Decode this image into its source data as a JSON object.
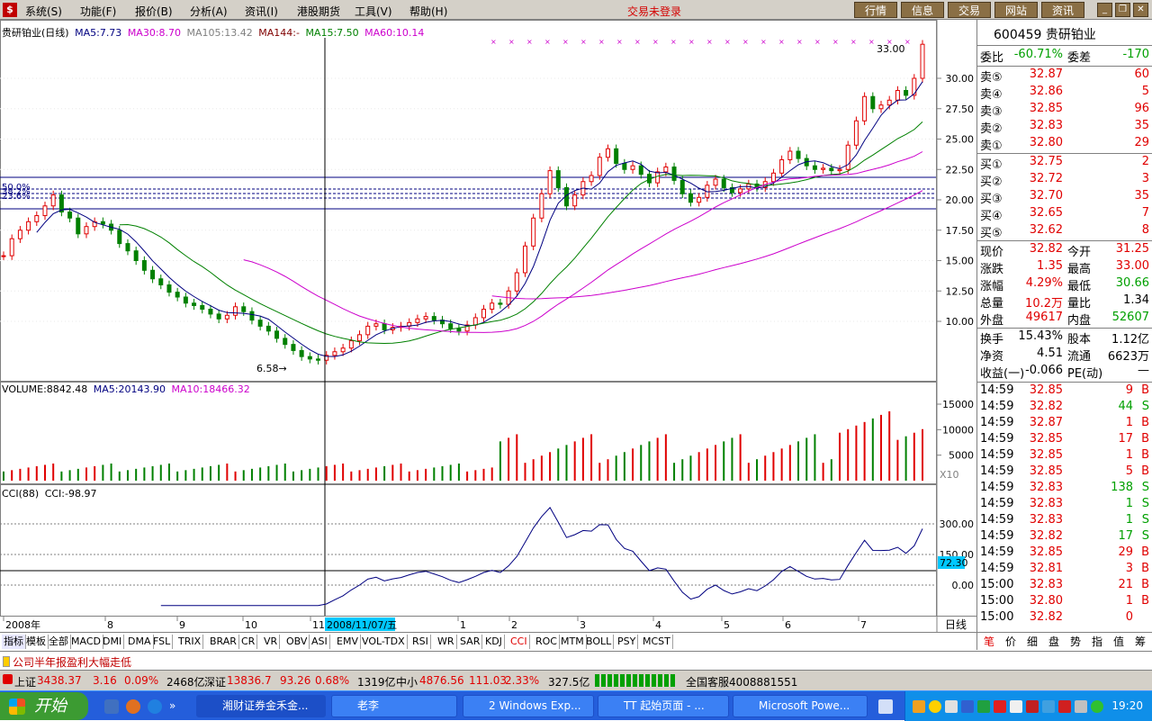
{
  "menubar": {
    "items": [
      "系统(S)",
      "功能(F)",
      "报价(B)",
      "分析(A)",
      "资讯(I)",
      "港股期货",
      "工具(V)",
      "帮助(H)"
    ],
    "login_status": "交易未登录",
    "nav_buttons": [
      "行情",
      "信息",
      "交易",
      "网站",
      "资讯"
    ]
  },
  "main_chart": {
    "legend": [
      {
        "text": "贵研铂业(日线)",
        "color": "#000000"
      },
      {
        "text": "MA5:7.73",
        "color": "#000080"
      },
      {
        "text": "MA30:8.70",
        "color": "#cc00cc"
      },
      {
        "text": "MA105:13.42",
        "color": "#808080"
      },
      {
        "text": "MA144:-",
        "color": "#800000"
      },
      {
        "text": "MA15:7.50",
        "color": "#008000"
      },
      {
        "text": "MA60:10.14",
        "color": "#cc00cc"
      }
    ],
    "price_axis": [
      "30.00",
      "27.50",
      "25.00",
      "22.50",
      "20.00",
      "17.50",
      "15.00",
      "12.50",
      "10.00"
    ],
    "high_label": "33.00",
    "low_label": "6.58",
    "fib_labels": [
      "50.0%",
      "38.2%",
      "23.6%"
    ]
  },
  "volume_chart": {
    "legend": [
      {
        "text": "VOLUME:8842.48",
        "color": "#000000"
      },
      {
        "text": "MA5:20143.90",
        "color": "#000080"
      },
      {
        "text": "MA10:18466.32",
        "color": "#cc00cc"
      }
    ],
    "axis": [
      "15000",
      "10000",
      "5000"
    ],
    "unit": "X10"
  },
  "cci_chart": {
    "legend": [
      {
        "text": "CCI(88)",
        "color": "#000000"
      },
      {
        "text": "CCI:-98.97",
        "color": "#000000"
      }
    ],
    "axis": [
      "300.00",
      "150.00",
      "0.00"
    ],
    "cursor_value": "72.30"
  },
  "date_axis": {
    "labels": [
      "2008年",
      "8",
      "9",
      "10",
      "11",
      "1",
      "2",
      "3",
      "4",
      "5",
      "6",
      "7"
    ],
    "cursor_date": "2008/11/07/五",
    "period": "日线"
  },
  "quote": {
    "code": "600459",
    "name": "贵研铂业",
    "weibi_label": "委比",
    "weibi": "-60.71%",
    "weicha_label": "委差",
    "weicha": "-170",
    "asks": [
      {
        "label": "卖⑤",
        "price": "32.87",
        "vol": "60"
      },
      {
        "label": "卖④",
        "price": "32.86",
        "vol": "5"
      },
      {
        "label": "卖③",
        "price": "32.85",
        "vol": "96"
      },
      {
        "label": "卖②",
        "price": "32.83",
        "vol": "35"
      },
      {
        "label": "卖①",
        "price": "32.80",
        "vol": "29"
      }
    ],
    "bids": [
      {
        "label": "买①",
        "price": "32.75",
        "vol": "2"
      },
      {
        "label": "买②",
        "price": "32.72",
        "vol": "3"
      },
      {
        "label": "买③",
        "price": "32.70",
        "vol": "35"
      },
      {
        "label": "买④",
        "price": "32.65",
        "vol": "7"
      },
      {
        "label": "买⑤",
        "price": "32.62",
        "vol": "8"
      }
    ],
    "stats1": [
      {
        "l1": "现价",
        "v1": "32.82",
        "l2": "今开",
        "v2": "31.25"
      },
      {
        "l1": "涨跌",
        "v1": "1.35",
        "l2": "最高",
        "v2": "33.00"
      },
      {
        "l1": "涨幅",
        "v1": "4.29%",
        "l2": "最低",
        "v2": "30.66"
      },
      {
        "l1": "总量",
        "v1": "10.2万",
        "l2": "量比",
        "v2": "1.34"
      },
      {
        "l1": "外盘",
        "v1": "49617",
        "l2": "内盘",
        "v2": "52607"
      }
    ],
    "stats2": [
      {
        "l1": "换手",
        "v1": "15.43%",
        "l2": "股本",
        "v2": "1.12亿"
      },
      {
        "l1": "净资",
        "v1": "4.51",
        "l2": "流通",
        "v2": "6623万"
      },
      {
        "l1": "收益(一)",
        "v1": "-0.066",
        "l2": "PE(动)",
        "v2": "—"
      }
    ],
    "ticks": [
      {
        "t": "14:59",
        "p": "32.85",
        "v": "9",
        "s": "B"
      },
      {
        "t": "14:59",
        "p": "32.82",
        "v": "44",
        "s": "S"
      },
      {
        "t": "14:59",
        "p": "32.87",
        "v": "1",
        "s": "B"
      },
      {
        "t": "14:59",
        "p": "32.85",
        "v": "17",
        "s": "B"
      },
      {
        "t": "14:59",
        "p": "32.85",
        "v": "1",
        "s": "B"
      },
      {
        "t": "14:59",
        "p": "32.85",
        "v": "5",
        "s": "B"
      },
      {
        "t": "14:59",
        "p": "32.83",
        "v": "138",
        "s": "S"
      },
      {
        "t": "14:59",
        "p": "32.83",
        "v": "1",
        "s": "S"
      },
      {
        "t": "14:59",
        "p": "32.83",
        "v": "1",
        "s": "S"
      },
      {
        "t": "14:59",
        "p": "32.82",
        "v": "17",
        "s": "S"
      },
      {
        "t": "14:59",
        "p": "32.85",
        "v": "29",
        "s": "B"
      },
      {
        "t": "14:59",
        "p": "32.81",
        "v": "3",
        "s": "B"
      },
      {
        "t": "15:00",
        "p": "32.83",
        "v": "21",
        "s": "B"
      },
      {
        "t": "15:00",
        "p": "32.80",
        "v": "1",
        "s": "B"
      },
      {
        "t": "15:00",
        "p": "32.82",
        "v": "0",
        "s": ""
      }
    ]
  },
  "indicator_tabs": [
    "指标",
    "模板",
    "全部",
    "MACD",
    "DMI",
    "DMA",
    "FSL",
    "TRIX",
    "BRAR",
    "CR",
    "VR",
    "OBV",
    "ASI",
    "EMV",
    "VOL-TDX",
    "RSI",
    "WR",
    "SAR",
    "KDJ",
    "CCI",
    "ROC",
    "MTM",
    "BOLL",
    "PSY",
    "MCST"
  ],
  "right_tabs": [
    "笔",
    "价",
    "细",
    "盘",
    "势",
    "指",
    "值",
    "筹"
  ],
  "news": "公司半年报盈利大幅走低",
  "status": {
    "sh_label": "上证",
    "sh_value": "3438.37",
    "sh_change": "3.16",
    "sh_pct": "0.09%",
    "sh_amount": "2468亿",
    "sz_label": "深证",
    "sz_value": "13836.7",
    "sz_change": "93.26",
    "sz_pct": "0.68%",
    "sz_amount": "1319亿",
    "zx_label": "中小",
    "zx_value": "4876.56",
    "zx_change": "111.03",
    "zx_pct": "2.33%",
    "zx_amount": "327.5亿",
    "hotline": "全国客服4008881551"
  },
  "taskbar": {
    "start": "开始",
    "buttons": [
      "湘财证券金禾金...",
      "老李",
      "2 Windows Exp...",
      "TT 起始页面 - ...",
      "Microsoft Powe..."
    ],
    "clock": "19:20"
  }
}
